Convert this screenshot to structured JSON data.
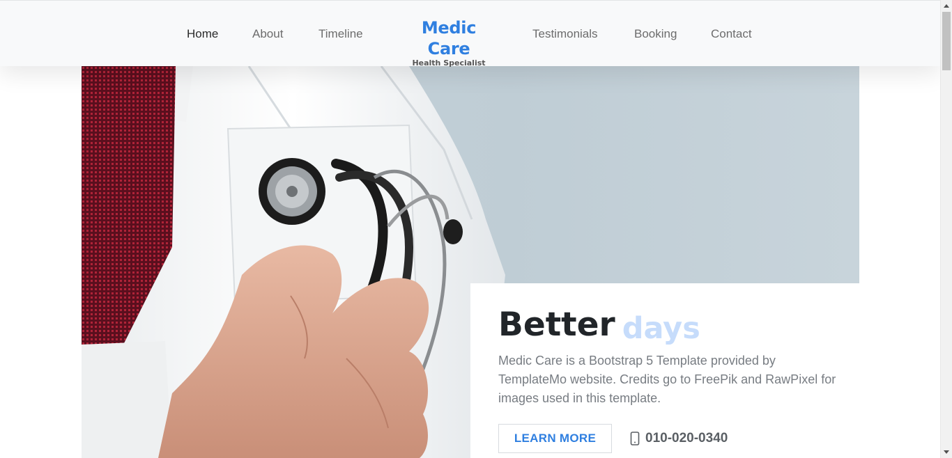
{
  "nav": {
    "items": [
      {
        "label": "Home",
        "active": true
      },
      {
        "label": "About"
      },
      {
        "label": "Timeline"
      },
      {
        "label": "Testimonials"
      },
      {
        "label": "Booking"
      },
      {
        "label": "Contact"
      }
    ],
    "brand": {
      "title": "Medic Care",
      "subtitle": "Health Specialist"
    }
  },
  "hero": {
    "image": "doctor-with-stethoscope-photo",
    "title_dark": "Better",
    "title_light": "days",
    "text": "Medic Care is a Bootstrap 5 Template provided by TemplateMo website. Credits go to FreePik and RawPixel for images used in this template.",
    "button_label": "LEARN MORE",
    "phone_icon": "mobile-phone-icon",
    "phone": "010-020-0340"
  },
  "colors": {
    "accent": "#2f7fe0",
    "accent_light": "#c6dcfb",
    "navbar_bg": "#f8f9fa",
    "hero_bg": "#c4d1d8"
  }
}
